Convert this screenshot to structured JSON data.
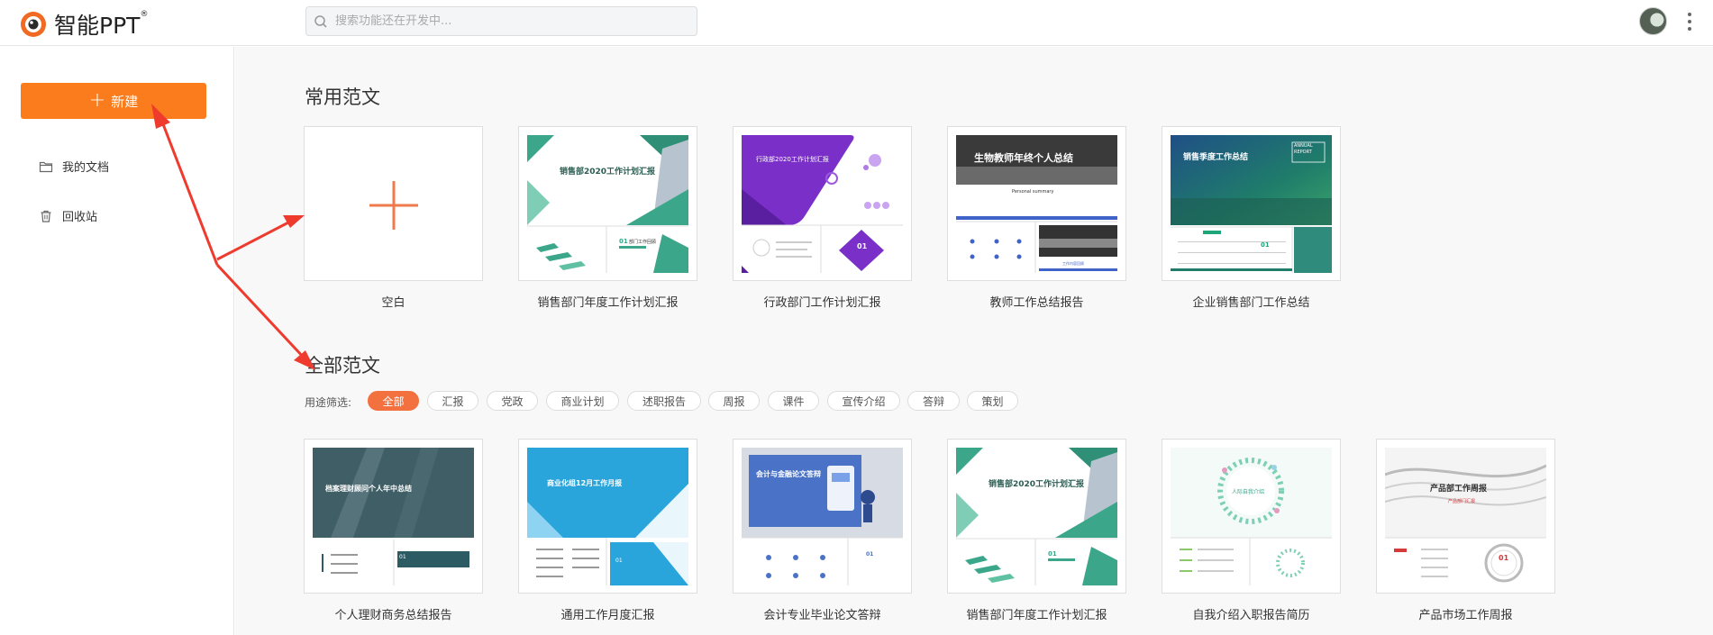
{
  "app": {
    "name": "智能PPT",
    "trademark": "®"
  },
  "search": {
    "placeholder": "搜索功能还在开发中..."
  },
  "sidebar": {
    "new_label": "新建",
    "items": [
      {
        "label": "我的文档",
        "icon": "folder-icon"
      },
      {
        "label": "回收站",
        "icon": "trash-icon"
      }
    ]
  },
  "common_section": {
    "title": "常用范文",
    "cards": [
      {
        "label": "空白"
      },
      {
        "label": "销售部门年度工作计划汇报"
      },
      {
        "label": "行政部门工作计划汇报"
      },
      {
        "label": "教师工作总结报告"
      },
      {
        "label": "企业销售部门工作总结"
      }
    ]
  },
  "all_section": {
    "title": "全部范文",
    "filter_label": "用途筛选:",
    "filters": [
      "全部",
      "汇报",
      "党政",
      "商业计划",
      "述职报告",
      "周报",
      "课件",
      "宣传介绍",
      "答辩",
      "策划"
    ],
    "active_filter": "全部",
    "cards": [
      {
        "label": "个人理财商务总结报告"
      },
      {
        "label": "通用工作月度汇报"
      },
      {
        "label": "会计专业毕业论文答辩"
      },
      {
        "label": "销售部门年度工作计划汇报"
      },
      {
        "label": "自我介绍入职报告简历"
      },
      {
        "label": "产品市场工作周报"
      }
    ]
  },
  "thumbnail_text": {
    "sales_2020": "销售部2020工作计划汇报",
    "admin_2020": "行政部2020工作计划汇报",
    "teacher_title": "生物教师年终个人总结",
    "teacher_sub": "Personal summary",
    "teacher_section": "工作内容回顾",
    "quarter_title": "销售季度工作总结",
    "quarter_badge_1": "ANNUAL",
    "quarter_badge_2": "REPORT",
    "num_01": "01",
    "dept_work": "部门工作回顾",
    "finance_title": "档案理财顾问个人年中总结",
    "month_title": "商业化组12月工作月报",
    "accounting_title": "会计与金融论文答辩",
    "self_title": "人际自我介绍",
    "product_title": "产品部工作周报",
    "product_sub": "产品部门汇报"
  },
  "colors": {
    "accent": "#fa7c1c",
    "chip_active": "#f2713e",
    "teal": "#3ba689",
    "purple": "#7b2fc9",
    "annotation_arrow": "#ee3b2e"
  }
}
